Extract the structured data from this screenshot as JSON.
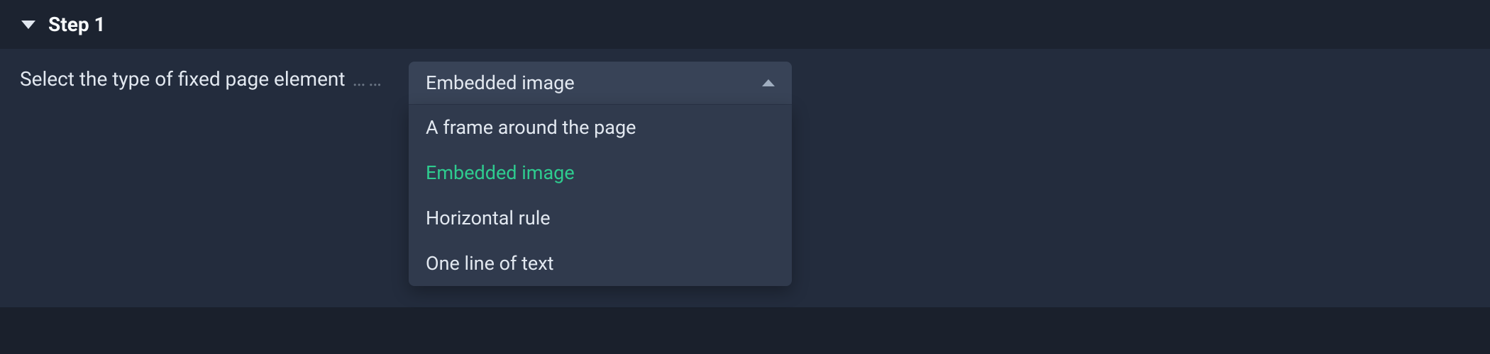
{
  "step": {
    "title": "Step 1",
    "label": "Select the type of fixed page element",
    "dots": "……"
  },
  "dropdown": {
    "selected": "Embedded image",
    "options": [
      {
        "label": "A frame around the page",
        "active": false
      },
      {
        "label": "Embedded image",
        "active": true
      },
      {
        "label": "Horizontal rule",
        "active": false
      },
      {
        "label": "One line of text",
        "active": false
      }
    ]
  }
}
